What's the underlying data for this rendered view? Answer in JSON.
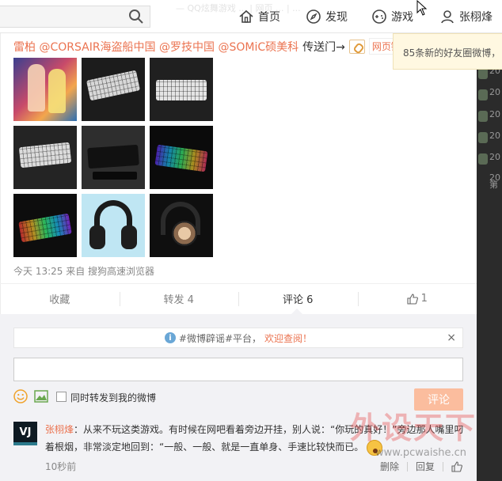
{
  "nav": {
    "search_placeholder": "",
    "ghost_text": "— QQ炫舞游戏 ... | 网页 ... | ...",
    "items": [
      {
        "label": "首页",
        "icon": "home-icon"
      },
      {
        "label": "发现",
        "icon": "compass-icon"
      },
      {
        "label": "游戏",
        "icon": "gamepad-icon"
      },
      {
        "label": "张栩烽",
        "icon": "user-icon"
      }
    ]
  },
  "tooltip": {
    "text": "85条新的好友圈微博，"
  },
  "right_strip": {
    "items": [
      "20",
      "20",
      "20",
      "20",
      "20",
      "20",
      "第"
    ]
  },
  "post": {
    "mentions_text": "雷柏 @CORSAIR海盗船中国 @罗技中国 @SOMiC硕美科",
    "link_prefix": "传送门→",
    "web_link": "网页链",
    "photos": [
      {
        "name": "anime-game-photo"
      },
      {
        "name": "white-keyboard-photo"
      },
      {
        "name": "white-keyboard-closeup-photo"
      },
      {
        "name": "white-keyboard-angled-photo"
      },
      {
        "name": "black-keyboard-photo"
      },
      {
        "name": "rgb-keyboard-dark-photo"
      },
      {
        "name": "rgb-keyboard-photo"
      },
      {
        "name": "black-headphones-photo"
      },
      {
        "name": "gold-headphones-photo"
      }
    ],
    "meta": "今天 13:25 来自 搜狗高速浏览器"
  },
  "actions": {
    "favorite": "收藏",
    "repost": "转发 4",
    "comment": "评论 6",
    "like": "1"
  },
  "notice": {
    "prefix": "#微博辟谣#平台，",
    "accent": "欢迎查阅！"
  },
  "composer": {
    "input_value": "",
    "repost_label": "同时转发到我的微博",
    "submit_label": "评论"
  },
  "comment": {
    "avatar_text": "VJ",
    "author": "张栩烽",
    "text": "：从来不玩这类游戏。有时候在网吧看着旁边开挂，别人说：“你玩的真好！”旁边那人嘴里叼着根烟，非常淡定地回到：“一般、一般、就是一直单身、手速比较快而已。",
    "time": "10秒前",
    "delete": "删除",
    "reply": "回复"
  },
  "watermark": {
    "text": "外设天下",
    "url": "www.pcwaishe.cn"
  },
  "colors": {
    "accent": "#eb7350",
    "submit_disabled": "#fbbd9e",
    "panel_bg": "#f2f2f5"
  }
}
